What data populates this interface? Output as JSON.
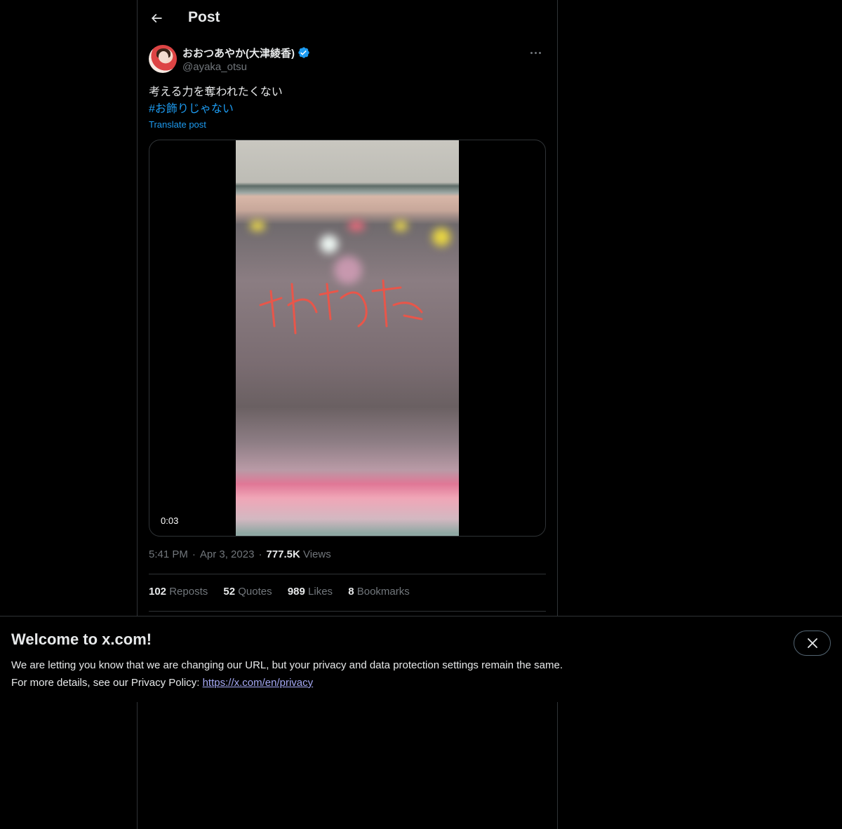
{
  "header": {
    "title": "Post",
    "back_icon": "arrow-left-icon"
  },
  "author": {
    "display_name": "おおつあやか(大津綾香)",
    "handle": "@ayaka_otsu",
    "verified": true,
    "verified_color": "#1d9bf0"
  },
  "post": {
    "text": "考える力を奪われたくない",
    "hashtag": "#お飾りじゃない",
    "translate_label": "Translate post",
    "video_duration": "0:03"
  },
  "meta": {
    "time": "5:41 PM",
    "date": "Apr 3, 2023",
    "views_count": "777.5K",
    "views_label": "Views"
  },
  "stats": {
    "reposts_count": "102",
    "reposts_label": "Reposts",
    "quotes_count": "52",
    "quotes_label": "Quotes",
    "likes_count": "989",
    "likes_label": "Likes",
    "bookmarks_count": "8",
    "bookmarks_label": "Bookmarks"
  },
  "banner": {
    "title": "Welcome to x.com!",
    "line1": "We are letting you know that we are changing our URL, but your privacy and data protection settings remain the same.",
    "line2_prefix": "For more details, see our Privacy Policy: ",
    "link_text": "https://x.com/en/privacy",
    "close_icon": "close-icon"
  },
  "colors": {
    "background": "#000000",
    "text": "#e7e9ea",
    "secondary": "#71767b",
    "accent": "#1d9bf0",
    "link": "#a5a9f5",
    "border": "#2f3336"
  }
}
